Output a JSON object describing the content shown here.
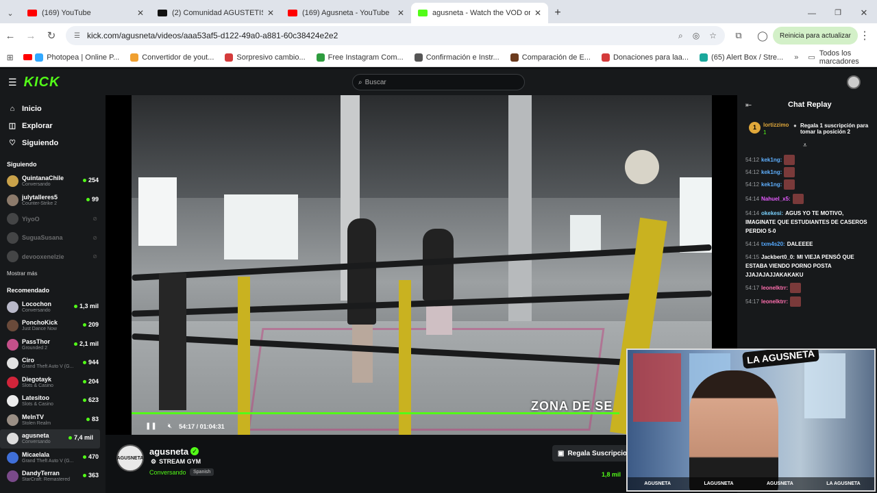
{
  "browser": {
    "tabs": [
      {
        "label": "(169) YouTube",
        "color": "#ff0000"
      },
      {
        "label": "(2) Comunidad AGUSTETISMO",
        "color": "#111111"
      },
      {
        "label": "(169) Agusneta - YouTube",
        "color": "#ff0000"
      },
      {
        "label": "agusneta - Watch the VOD on",
        "color": "#53fc18"
      }
    ],
    "new_tab": "+",
    "url": "kick.com/agusneta/videos/aaa53af5-d122-49a0-a881-60c38424e2e2",
    "update_button": "Reinicia para actualizar",
    "bookmarks": [
      "Photopea | Online P...",
      "Convertidor de yout...",
      "Sorpresivo cambio...",
      "Free Instagram Com...",
      "Confirmación e Instr...",
      "Comparación de E...",
      "Donaciones para laa...",
      "(65) Alert Box / Stre..."
    ],
    "all_bookmarks": "Todos los marcadores"
  },
  "kick": {
    "logo": "KICK",
    "search_placeholder": "Buscar",
    "nav": [
      {
        "label": "Inicio",
        "icon": "home-icon",
        "glyph": "⌂"
      },
      {
        "label": "Explorar",
        "icon": "compass-icon",
        "glyph": "◫"
      },
      {
        "label": "Siguiendo",
        "icon": "heart-icon",
        "glyph": "♡"
      }
    ],
    "following_title": "Siguiendo",
    "following": [
      {
        "name": "QuintanaChile",
        "sub": "Conversando",
        "viewers": "254",
        "color": "#c9a24a",
        "live": true
      },
      {
        "name": "julytalleres5",
        "sub": "Counter-Strike 2",
        "viewers": "99",
        "color": "#8c7a6b",
        "live": true
      },
      {
        "name": "YiyoO",
        "sub": "",
        "viewers": "",
        "color": "#999999",
        "live": false
      },
      {
        "name": "SuguaSusana",
        "sub": "",
        "viewers": "",
        "color": "#999999",
        "live": false
      },
      {
        "name": "devooxenelzie",
        "sub": "",
        "viewers": "",
        "color": "#999999",
        "live": false
      }
    ],
    "show_more": "Mostrar más",
    "recommended_title": "Recomendado",
    "recommended": [
      {
        "name": "Locochon",
        "sub": "Conversando",
        "viewers": "1,3 mil",
        "color": "#b9b9c9",
        "selected": false
      },
      {
        "name": "PonchoKick",
        "sub": "Just Dance Now",
        "viewers": "209",
        "color": "#6a4a3a",
        "selected": false
      },
      {
        "name": "PassThor",
        "sub": "Grounded 2",
        "viewers": "2,1 mil",
        "color": "#c4508a",
        "selected": false
      },
      {
        "name": "Ciro",
        "sub": "Grand Theft Auto V (G...",
        "viewers": "944",
        "color": "#e2e2e2",
        "selected": false
      },
      {
        "name": "Diegotayk",
        "sub": "Slots & Casino",
        "viewers": "204",
        "color": "#d1243a",
        "selected": false
      },
      {
        "name": "Latesitoo",
        "sub": "Slots & Casino",
        "viewers": "623",
        "color": "#ececec",
        "selected": false
      },
      {
        "name": "MelnTV",
        "sub": "Stolen Realm",
        "viewers": "83",
        "color": "#9a8f85",
        "selected": false
      },
      {
        "name": "agusneta",
        "sub": "Conversando",
        "viewers": "7,4 mil",
        "color": "#dddddd",
        "selected": true
      },
      {
        "name": "Micaelala",
        "sub": "Grand Theft Auto V (G...",
        "viewers": "470",
        "color": "#3f6fd8",
        "selected": false
      },
      {
        "name": "DandyTerran",
        "sub": "StarCraft: Remastered",
        "viewers": "363",
        "color": "#7a4a8a",
        "selected": false
      }
    ]
  },
  "video": {
    "overlay_text": "ZONA DE SE",
    "time": "54:17 / 01:04:31",
    "progress": 0.841
  },
  "channel": {
    "avatar_text": "AGUSNETA",
    "name": "agusneta",
    "title": "STREAM GYM",
    "category": "Conversando",
    "language": "Spanish",
    "sub_button": "Regala Suscripciones",
    "viewers": "1,8 mil"
  },
  "chat": {
    "title": "Chat Replay",
    "pinned": {
      "rank": "1",
      "user": "lortizzimo",
      "count": "1",
      "text": "Regala 1 suscripción para tomar la posición 2"
    },
    "messages": [
      {
        "time": "54:12",
        "user": "kek1ng:",
        "color": "#5fb0ff",
        "text": "",
        "emote": true
      },
      {
        "time": "54:12",
        "user": "kek1ng:",
        "color": "#5fb0ff",
        "text": "",
        "emote": true
      },
      {
        "time": "54:12",
        "user": "kek1ng:",
        "color": "#5fb0ff",
        "text": "",
        "emote": true
      },
      {
        "time": "54:14",
        "user": "Nahuel_x5:",
        "color": "#e65cff",
        "text": "",
        "emote": true
      },
      {
        "time": "54:14",
        "user": "okekesi:",
        "color": "#7bd3ff",
        "text": "AGUS YO TE MOTIVO, IMAGINATE QUE ESTUDIANTES DE CASEROS PERDIO 5-0",
        "emote": false
      },
      {
        "time": "54:14",
        "user": "txm4s20:",
        "color": "#55aaff",
        "text": "DALEEEE",
        "emote": false
      },
      {
        "time": "54:15",
        "user": "Jackbert0_0:",
        "color": "#ffffff",
        "text": "MI VIEJA PENSÓ QUE ESTABA VIENDO PORNO POSTA JJAJAJAJJAKAKAKU",
        "emote": false
      },
      {
        "time": "54:17",
        "user": "leonelktrr:",
        "color": "#ff6fae",
        "text": "",
        "emote": true
      },
      {
        "time": "54:17",
        "user": "leonelktrr:",
        "color": "#ff6fae",
        "text": "",
        "emote": true
      }
    ]
  },
  "webcam": {
    "badge": "LA AGUSNETA",
    "footer": [
      "AGUSNETA",
      "LAGUSNETA",
      "AGUSNETA",
      "LA AGUSNETA"
    ]
  }
}
